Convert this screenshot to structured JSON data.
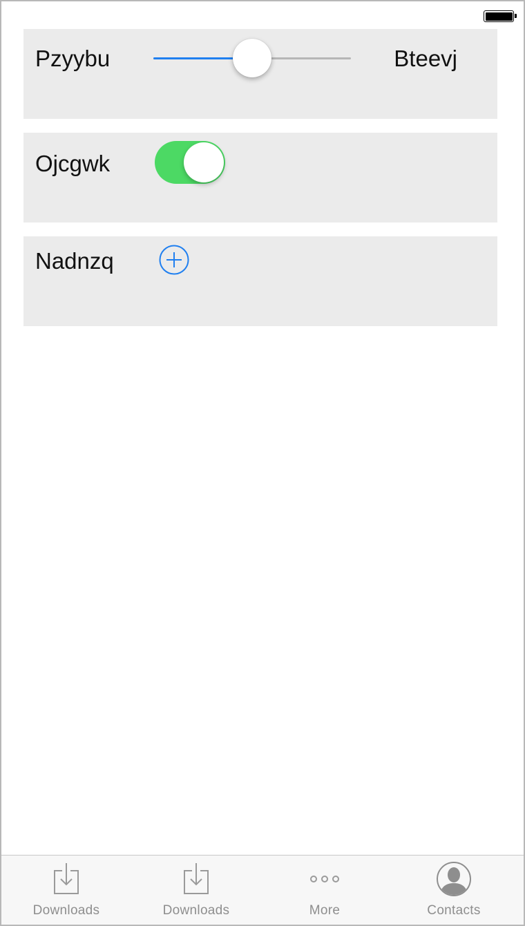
{
  "status_bar": {
    "battery_icon": "battery-full-icon"
  },
  "rows": {
    "slider_row": {
      "label": "Pzyybu",
      "slider_value": 0.5,
      "max_label": "Bteevj",
      "accent_color": "#1f7ff0"
    },
    "switch_row": {
      "label": "Ojcgwk",
      "switch_on": true,
      "on_color": "#4cd964"
    },
    "add_row": {
      "label": "Nadnzq",
      "icon": "plus-circle-icon",
      "icon_color": "#1f7ff0"
    }
  },
  "tab_bar": {
    "tabs": [
      {
        "label": "Downloads",
        "icon": "downloads-icon"
      },
      {
        "label": "Downloads",
        "icon": "downloads-icon"
      },
      {
        "label": "More",
        "icon": "more-icon"
      },
      {
        "label": "Contacts",
        "icon": "contacts-icon"
      }
    ]
  }
}
